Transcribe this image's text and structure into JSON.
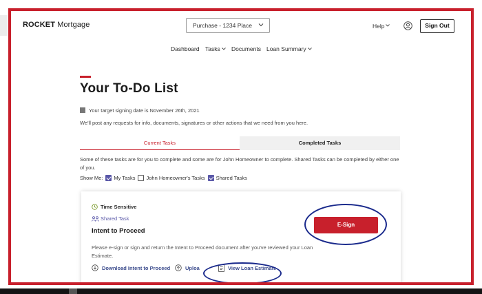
{
  "header": {
    "logo_bold": "ROCKET",
    "logo_rest": " Mortgage",
    "property_select": "Purchase - 1234 Place",
    "help_label": "Help",
    "signout_label": "Sign Out"
  },
  "nav": {
    "items": [
      "Dashboard",
      "Tasks",
      "Documents",
      "Loan Summary"
    ]
  },
  "main": {
    "title": "Your To-Do List",
    "signing_date": "Your target signing date is November 26th, 2021",
    "post_note": "We'll post any requests for info, documents, signatures or other actions that we need from you here.",
    "tabs": [
      {
        "label": "Current Tasks",
        "active": true
      },
      {
        "label": "Completed Tasks",
        "active": false
      }
    ],
    "tab_description": "Some of these tasks are for you to complete and some are for John Homeowner to complete. Shared Tasks can be completed by either one of you.",
    "show_me": {
      "label": "Show Me:",
      "filters": [
        {
          "label": "My Tasks",
          "checked": true
        },
        {
          "label": "John Homeowner's Tasks",
          "checked": false
        },
        {
          "label": "Shared Tasks",
          "checked": true
        }
      ]
    }
  },
  "task_card": {
    "badge": "Time Sensitive",
    "type": "Shared Task",
    "title": "Intent to Proceed",
    "description": "Please e-sign or sign and return the Intent to Proceed document after you've reviewed your Loan Estimate.",
    "esign_label": "E-Sign",
    "actions": [
      {
        "label": "Download Intent to Proceed",
        "icon": "download-icon"
      },
      {
        "label": "Uploa",
        "icon": "upload-icon"
      },
      {
        "label": "View Loan Estimate",
        "icon": "document-icon"
      }
    ]
  },
  "colors": {
    "brand_red": "#c8202c",
    "annotation_blue": "#1a2a8c",
    "checkbox_purple": "#5a58a8"
  }
}
